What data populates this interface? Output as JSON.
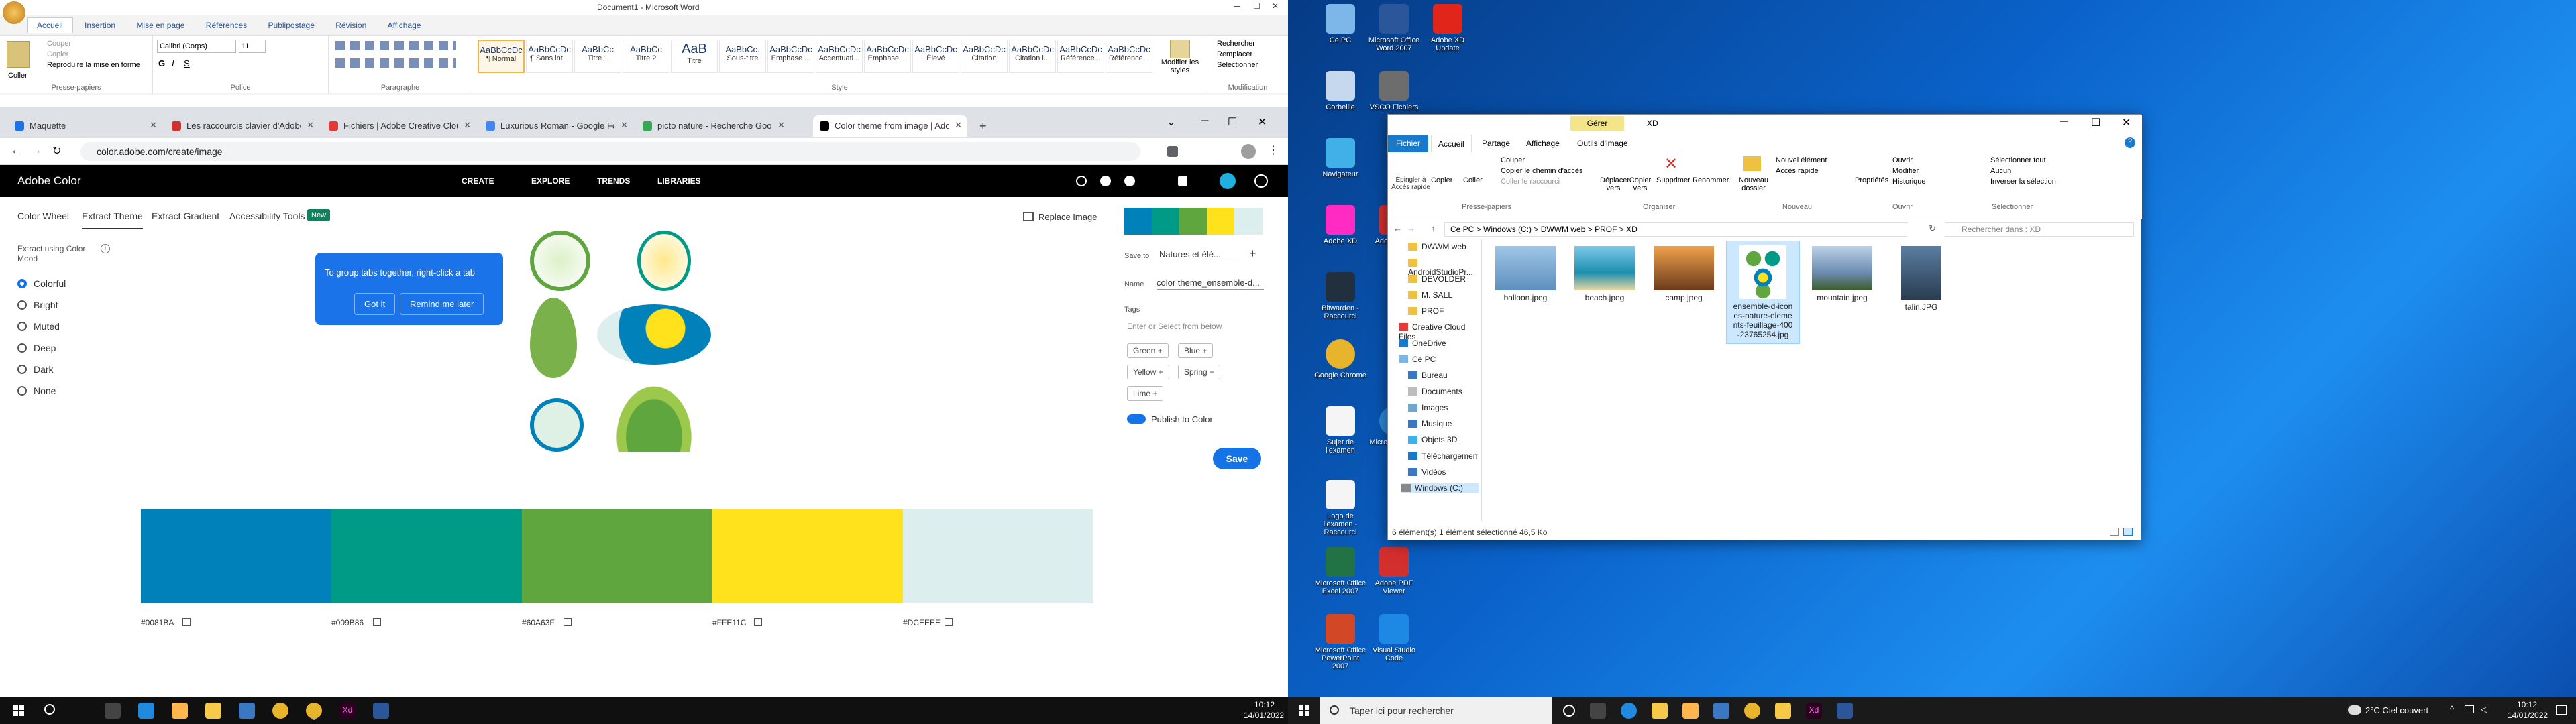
{
  "word": {
    "title": "Document1 - Microsoft Word",
    "tabs": [
      "Fichier",
      "Accueil",
      "Insertion",
      "Mise en page",
      "Références",
      "Publipostage",
      "Révision",
      "Affichage"
    ],
    "clipboard": {
      "paste": "Coller",
      "cut": "Couper",
      "copy": "Copier",
      "format_painter": "Reproduire la mise en forme",
      "group": "Presse-papiers"
    },
    "font": {
      "name": "Calibri (Corps)",
      "size": "11",
      "group": "Police"
    },
    "paragraph_group": "Paragraphe",
    "styles": [
      {
        "preview": "AaBbCcDc",
        "name": "¶ Normal"
      },
      {
        "preview": "AaBbCcDc",
        "name": "¶ Sans int..."
      },
      {
        "preview": "AaBbCc",
        "name": "Titre 1"
      },
      {
        "preview": "AaBbCc",
        "name": "Titre 2"
      },
      {
        "preview": "AaB",
        "name": "Titre"
      },
      {
        "preview": "AaBbCc.",
        "name": "Sous-titre"
      },
      {
        "preview": "AaBbCcDc",
        "name": "Emphase ..."
      },
      {
        "preview": "AaBbCcDc",
        "name": "Accentuati..."
      },
      {
        "preview": "AaBbCcDc",
        "name": "Emphase ..."
      },
      {
        "preview": "AaBbCcDc",
        "name": "Élevé"
      },
      {
        "preview": "AaBbCcDc",
        "name": "Citation"
      },
      {
        "preview": "AaBbCcDc",
        "name": "Citation i..."
      },
      {
        "preview": "AaBbCcDc",
        "name": "Référence..."
      },
      {
        "preview": "AaBbCcDc",
        "name": "Référence..."
      }
    ],
    "styles_group": "Style",
    "modify_styles": "Modifier les styles",
    "editing": {
      "find": "Rechercher",
      "replace": "Remplacer",
      "select": "Sélectionner",
      "group": "Modification"
    }
  },
  "chrome": {
    "tabs": [
      {
        "title": "Maquette",
        "color": "#1a73e8"
      },
      {
        "title": "Les raccourcis clavier d'Adobe II",
        "color": "#d32f2f"
      },
      {
        "title": "Fichiers | Adobe Creative Cloud",
        "color": "#e53935"
      },
      {
        "title": "Luxurious Roman - Google Fonts",
        "color": "#4285f4"
      },
      {
        "title": "picto nature - Recherche Google",
        "color": "#34a853"
      },
      {
        "title": "Color theme from image | Adob...",
        "color": "#000000"
      }
    ],
    "url": "color.adobe.com/create/image",
    "popup": {
      "text": "To group tabs together, right-click a tab",
      "ok": "Got it",
      "later": "Remind me later"
    }
  },
  "adobe": {
    "brand": "Adobe Color",
    "nav": [
      "CREATE",
      "EXPLORE",
      "TRENDS",
      "LIBRARIES"
    ],
    "subtabs": [
      "Color Wheel",
      "Extract Theme",
      "Extract Gradient",
      "Accessibility Tools"
    ],
    "new_badge": "New",
    "replace_image": "Replace Image",
    "mood_label": "Extract using Color Mood",
    "moods": [
      "Colorful",
      "Bright",
      "Muted",
      "Deep",
      "Dark",
      "None"
    ],
    "palette": [
      {
        "hex": "#0081BA",
        "color": "#0081BA"
      },
      {
        "hex": "#009B86",
        "color": "#009B86"
      },
      {
        "hex": "#60A63F",
        "color": "#60A63F"
      },
      {
        "hex": "#FFE11C",
        "color": "#FFE11C"
      },
      {
        "hex": "#DCEEEE",
        "color": "#DCEEEE"
      }
    ],
    "save_to_label": "Save to",
    "save_to_value": "Natures et élé...",
    "name_label": "Name",
    "name_value": "color theme_ensemble-d...",
    "tags_label": "Tags",
    "tags_placeholder": "Enter or Select from below",
    "tags": [
      "Green",
      "Blue",
      "Yellow",
      "Spring",
      "Lime"
    ],
    "publish": "Publish to Color",
    "save": "Save"
  },
  "taskbar_left": {
    "time": "10:12",
    "date": "14/01/2022"
  },
  "desktop_icons": [
    {
      "label": "Ce PC",
      "color": "#7db6e8"
    },
    {
      "label": "Microsoft Office Word 2007",
      "color": "#2b579a"
    },
    {
      "label": "Adobe XD Update",
      "color": "#e1251b"
    },
    {
      "label": "Corbeille",
      "color": "#c6d8ee"
    },
    {
      "label": "VSCO Fichiers",
      "color": "#6d6d6d"
    },
    {
      "label": "Navigateur",
      "color": "#3fb0e8"
    },
    {
      "label": "Adobe XD",
      "color": "#ff2bc2"
    },
    {
      "label": "Adobe PDF",
      "color": "#d32f2f"
    },
    {
      "label": "Bitwarden - Raccourci",
      "color": "#222f3e"
    },
    {
      "label": "Google Chrome",
      "color": "#e8b42c"
    },
    {
      "label": "Microsoft Edge",
      "color": "#2c8ad8"
    },
    {
      "label": "Sujet de l'examen",
      "color": "#f5f5f5"
    },
    {
      "label": "Logo de l'examen - Raccourci",
      "color": "#f5f5f5"
    },
    {
      "label": "Microsoft Office Excel 2007",
      "color": "#217346"
    },
    {
      "label": "Adobe PDF Viewer",
      "color": "#d32f2f"
    },
    {
      "label": "Microsoft Office PowerPoint 2007",
      "color": "#d24726"
    },
    {
      "label": "Visual Studio Code",
      "color": "#1e88e5"
    }
  ],
  "explorer": {
    "title": "XD",
    "context_tab": "Gérer",
    "tabs": [
      "Fichier",
      "Accueil",
      "Partage",
      "Affichage",
      "Outils d'image"
    ],
    "ribbon": {
      "pin": "Épingler à Accès rapide",
      "copy": "Copier",
      "paste": "Coller",
      "cut": "Couper",
      "copy_path": "Copier le chemin d'accès",
      "paste_shortcut": "Coller le raccourci",
      "clipboard_group": "Presse-papiers",
      "move_to": "Déplacer vers",
      "copy_to": "Copier vers",
      "delete": "Supprimer",
      "rename": "Renommer",
      "organize_group": "Organiser",
      "new_folder": "Nouveau dossier",
      "new_item": "Nouvel élément",
      "quick_access": "Accès rapide",
      "new_group": "Nouveau",
      "properties": "Propriétés",
      "open": "Ouvrir",
      "edit": "Modifier",
      "history": "Historique",
      "open_group": "Ouvrir",
      "select_all": "Sélectionner tout",
      "select_none": "Aucun",
      "invert": "Inverser la sélection",
      "select_group": "Sélectionner"
    },
    "breadcrumb": [
      "Ce PC",
      "Windows (C:)",
      "DWWM web",
      "PROF",
      "XD"
    ],
    "search_placeholder": "Rechercher dans : XD",
    "nav": [
      "DWWM web",
      "AndroidStudioPr...",
      "DEVOLDER",
      "M. SALL",
      "PROF",
      "Creative Cloud Files",
      "OneDrive",
      "Ce PC",
      "Bureau",
      "Documents",
      "Images",
      "Musique",
      "Objets 3D",
      "Téléchargements",
      "Vidéos",
      "Windows (C:)"
    ],
    "files": [
      {
        "name": "balloon.jpeg",
        "color": "#6fa8cf"
      },
      {
        "name": "beach.jpeg",
        "color": "#3aa6c9"
      },
      {
        "name": "camp.jpeg",
        "color": "#d9823a"
      },
      {
        "name": "ensemble-d-icon es-nature-eleme nts-feuillage-400 -23765254.jpg",
        "color": "#ffffff"
      },
      {
        "name": "mountain.jpeg",
        "color": "#7a9cc0"
      },
      {
        "name": "talin.JPG",
        "color": "#3c5a78"
      }
    ],
    "status": "6 élément(s)     1 élément sélectionné  46,5 Ko"
  },
  "taskbar_right": {
    "search": "Taper ici pour rechercher",
    "weather": "2°C  Ciel couvert",
    "time": "10:12",
    "date": "14/01/2022"
  }
}
